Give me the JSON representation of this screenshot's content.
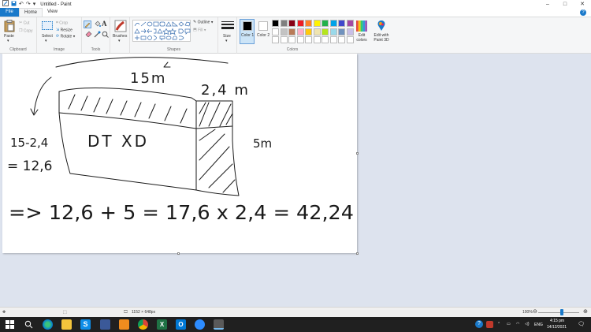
{
  "window": {
    "title": "Untitled - Paint"
  },
  "tabs": [
    {
      "label": "File"
    },
    {
      "label": "Home"
    },
    {
      "label": "View"
    }
  ],
  "ribbon": {
    "clipboard": {
      "label": "Clipboard",
      "paste": "Paste",
      "cut": "Cut",
      "copy": "Copy"
    },
    "image": {
      "label": "Image",
      "select": "Select",
      "crop": "Crop",
      "resize": "Resize",
      "rotate": "Rotate"
    },
    "tools": {
      "label": "Tools",
      "brushes": "Brushes"
    },
    "shapes": {
      "label": "Shapes",
      "outline": "Outline",
      "fill": "Fill"
    },
    "size": {
      "label": "Size"
    },
    "colors": {
      "label": "Colors",
      "color1": "Color 1",
      "color2": "Color 2",
      "edit_colors": "Edit colors",
      "edit_3d": "Edit with Paint 3D",
      "palette_row1": [
        "#000000",
        "#7f7f7f",
        "#880015",
        "#ed1c24",
        "#ff7f27",
        "#fff200",
        "#22b14c",
        "#00a2e8",
        "#3f48cc",
        "#a349a4"
      ],
      "palette_row2": [
        "#ffffff",
        "#c3c3c3",
        "#b97a57",
        "#ffaec9",
        "#ffc90e",
        "#efe4b0",
        "#b5e61d",
        "#99d9ea",
        "#7092be",
        "#c8bfe7"
      ],
      "palette_row3": [
        "#ffffff",
        "#ffffff",
        "#ffffff",
        "#ffffff",
        "#ffffff",
        "#ffffff",
        "#ffffff",
        "#ffffff",
        "#ffffff",
        "#ffffff"
      ]
    }
  },
  "drawing": {
    "top_dim": "15m",
    "right_top_dim": "2,4 m",
    "left_expr": "15-2,4",
    "left_result": "= 12,6",
    "center_text": "DT XD",
    "right_dim": "5m",
    "bottom_eq": "=> 12,6 + 5 = 17,6 x 2,4 = 42,24"
  },
  "status": {
    "dimensions": "1152 × 648px",
    "zoom": "100%"
  },
  "taskbar": {
    "time": "4:15 pm",
    "date": "14/12/2021",
    "lang": "ENG"
  }
}
